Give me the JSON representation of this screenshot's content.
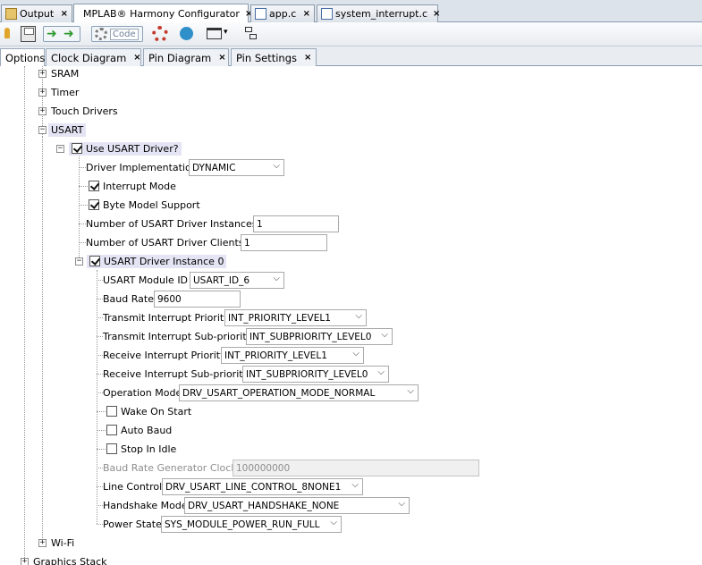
{
  "editor_tabs": [
    {
      "label": "Output",
      "icon": "output-icon"
    },
    {
      "label": "MPLAB® Harmony Configurator",
      "icon": "harmony-configurator-icon"
    },
    {
      "label": "app.c",
      "icon": "c-file-icon"
    },
    {
      "label": "system_interrupt.c",
      "icon": "c-file-icon"
    }
  ],
  "toolbar": {
    "code_label": "Code"
  },
  "panel_tabs": [
    {
      "label": "Options"
    },
    {
      "label": "Clock Diagram"
    },
    {
      "label": "Pin Diagram"
    },
    {
      "label": "Pin Settings"
    }
  ],
  "close_glyph": "×",
  "tree": {
    "sram": "SRAM",
    "timer": "Timer",
    "touch": "Touch Drivers",
    "usart": "USART",
    "use_usart": {
      "label": "Use USART Driver?",
      "checked": true
    },
    "driver_impl": {
      "label": "Driver Implementation",
      "value": "DYNAMIC"
    },
    "interrupt_mode": {
      "label": "Interrupt Mode",
      "checked": true
    },
    "byte_model": {
      "label": "Byte Model Support",
      "checked": true
    },
    "num_instances": {
      "label": "Number of USART Driver Instances",
      "value": "1"
    },
    "num_clients": {
      "label": "Number of USART Driver Clients",
      "value": "1"
    },
    "instance0": {
      "label": "USART Driver Instance 0",
      "checked": true
    },
    "module_id": {
      "label": "USART Module ID",
      "value": "USART_ID_6"
    },
    "baud_rate": {
      "label": "Baud Rate",
      "value": "9600"
    },
    "tx_prio": {
      "label": "Transmit Interrupt Priority",
      "value": "INT_PRIORITY_LEVEL1"
    },
    "tx_subprio": {
      "label": "Transmit Interrupt Sub-priority",
      "value": "INT_SUBPRIORITY_LEVEL0"
    },
    "rx_prio": {
      "label": "Receive Interrupt Priority",
      "value": "INT_PRIORITY_LEVEL1"
    },
    "rx_subprio": {
      "label": "Receive Interrupt Sub-priority",
      "value": "INT_SUBPRIORITY_LEVEL0"
    },
    "op_mode": {
      "label": "Operation Mode",
      "value": "DRV_USART_OPERATION_MODE_NORMAL"
    },
    "wake_on_start": {
      "label": "Wake On Start",
      "checked": false
    },
    "auto_baud": {
      "label": "Auto Baud",
      "checked": false
    },
    "stop_idle": {
      "label": "Stop In Idle",
      "checked": false
    },
    "brg_clock": {
      "label": "Baud Rate Generator Clock",
      "value": "100000000",
      "disabled": true
    },
    "line_control": {
      "label": "Line Control",
      "value": "DRV_USART_LINE_CONTROL_8NONE1"
    },
    "handshake": {
      "label": "Handshake Mode",
      "value": "DRV_USART_HANDSHAKE_NONE"
    },
    "power_state": {
      "label": "Power State",
      "value": "SYS_MODULE_POWER_RUN_FULL"
    },
    "wifi": "Wi-Fi",
    "graphics": "Graphics Stack"
  }
}
